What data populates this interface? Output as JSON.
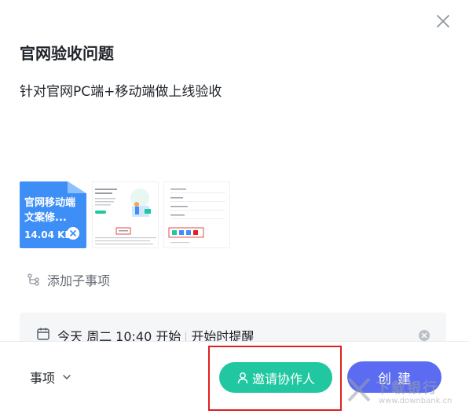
{
  "dialog": {
    "title": "官网验收问题",
    "description": "针对官网PC端+移动端做上线验收"
  },
  "attachments": {
    "file": {
      "name": "官网移动端文案修...",
      "size": "14.04 KB",
      "icon": "file-icon"
    },
    "images": [
      {
        "name": "screenshot-thumbnail-1"
      },
      {
        "name": "screenshot-thumbnail-2"
      }
    ]
  },
  "subtask": {
    "label": "添加子事项",
    "icon": "subtask-icon"
  },
  "date": {
    "start": "今天 周二 10:40 开始",
    "reminder": "开始时提醒",
    "icon": "calendar-icon"
  },
  "footer": {
    "type_label": "事项",
    "invite_label": "邀请协作人",
    "create_label": "创建"
  },
  "colors": {
    "invite": "#21c7a0",
    "create": "#5b6cf2",
    "file_card": "#3d8ef6",
    "highlight": "#e02020"
  },
  "watermark": {
    "name": "下载银行",
    "url": "www.downbank.cn"
  }
}
